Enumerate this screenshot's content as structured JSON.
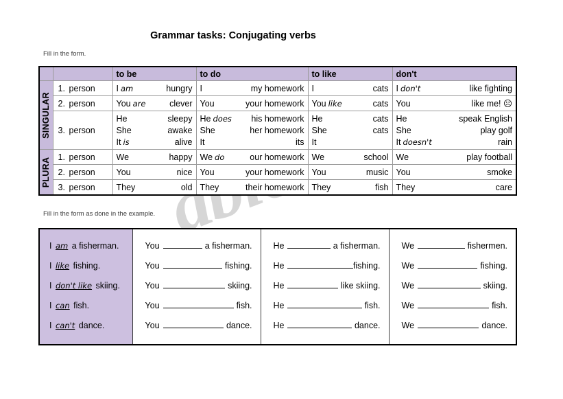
{
  "title": "Grammar tasks: Conjugating verbs",
  "instruction_1": "Fill in the form.",
  "instruction_2": "Fill in the form as done in the example.",
  "watermark": "ables.com",
  "colors": {
    "header_lavender": "#c8bbdc",
    "example_lavender": "#cdc0e0",
    "border": "#9a9a9a",
    "watermark_gray": "#c9c9c9"
  },
  "conjugation": {
    "headers": {
      "corner_a": "",
      "corner_b": "",
      "to_be": "to be",
      "to_do": "to do",
      "to_like": "to like",
      "dont": "don't"
    },
    "groups": [
      {
        "label": "SINGULAR"
      },
      {
        "label": "PLURA"
      }
    ],
    "singular": [
      {
        "person": "1.",
        "person_word": "person",
        "to_be": {
          "lines": [
            {
              "pronoun": "I",
              "answer": "am",
              "tail": "hungry"
            }
          ]
        },
        "to_do": {
          "lines": [
            {
              "pronoun": "I",
              "answer": "",
              "tail": "my homework"
            }
          ]
        },
        "to_like": {
          "lines": [
            {
              "pronoun": "I",
              "answer": "",
              "tail": "cats"
            }
          ]
        },
        "dont": {
          "lines": [
            {
              "pronoun": "I",
              "answer": "don't",
              "tail": "like fighting",
              "inline": true
            }
          ]
        }
      },
      {
        "person": "2.",
        "person_word": "person",
        "to_be": {
          "lines": [
            {
              "pronoun": "You",
              "answer": "are",
              "tail": "clever",
              "inline": true
            }
          ]
        },
        "to_do": {
          "lines": [
            {
              "pronoun": "You",
              "answer": "",
              "tail": "your homework"
            }
          ]
        },
        "to_like": {
          "lines": [
            {
              "pronoun": "You",
              "answer": "like",
              "tail": "cats",
              "inline": true
            }
          ]
        },
        "dont": {
          "lines": [
            {
              "pronoun": "You",
              "answer": "",
              "tail": "like me! ☹"
            }
          ]
        }
      },
      {
        "person": "3.",
        "person_word": "person",
        "to_be": {
          "lines": [
            {
              "pronoun": "He",
              "answer": "",
              "tail": "sleepy"
            },
            {
              "pronoun": "She",
              "answer": "",
              "tail": "awake"
            },
            {
              "pronoun": "It",
              "answer": "is",
              "tail": "alive"
            }
          ]
        },
        "to_do": {
          "lines": [
            {
              "pronoun": "He",
              "answer": "does",
              "tail": "his homework",
              "inline": true
            },
            {
              "pronoun": "She",
              "answer": "",
              "tail": "her homework"
            },
            {
              "pronoun": "It",
              "answer": "",
              "tail": "its"
            }
          ]
        },
        "to_like": {
          "lines": [
            {
              "pronoun": "He",
              "answer": "",
              "tail": "cats"
            },
            {
              "pronoun": "She",
              "answer": "",
              "tail": "cats"
            },
            {
              "pronoun": "It",
              "answer": "",
              "tail": ""
            }
          ]
        },
        "dont": {
          "lines": [
            {
              "pronoun": "He",
              "answer": "",
              "tail": "speak English"
            },
            {
              "pronoun": "She",
              "answer": "",
              "tail": "play golf"
            },
            {
              "pronoun": "It",
              "answer": "doesn't",
              "tail": "rain",
              "inline": true
            }
          ]
        }
      }
    ],
    "plural": [
      {
        "person": "1.",
        "person_word": "person",
        "to_be": {
          "lines": [
            {
              "pronoun": "We",
              "answer": "",
              "tail": "happy"
            }
          ]
        },
        "to_do": {
          "lines": [
            {
              "pronoun": "We",
              "answer": "do",
              "tail": "our homework",
              "inline": true
            }
          ]
        },
        "to_like": {
          "lines": [
            {
              "pronoun": "We",
              "answer": "",
              "tail": "school"
            }
          ]
        },
        "dont": {
          "lines": [
            {
              "pronoun": "We",
              "answer": "",
              "tail": "play football"
            }
          ]
        }
      },
      {
        "person": "2.",
        "person_word": "person",
        "to_be": {
          "lines": [
            {
              "pronoun": "You",
              "answer": "",
              "tail": "nice"
            }
          ]
        },
        "to_do": {
          "lines": [
            {
              "pronoun": "You",
              "answer": "",
              "tail": "your homework"
            }
          ]
        },
        "to_like": {
          "lines": [
            {
              "pronoun": "You",
              "answer": "",
              "tail": "music"
            }
          ]
        },
        "dont": {
          "lines": [
            {
              "pronoun": "You",
              "answer": "",
              "tail": "smoke"
            }
          ]
        }
      },
      {
        "person": "3.",
        "person_word": "person",
        "to_be": {
          "lines": [
            {
              "pronoun": "They",
              "answer": "",
              "tail": "old"
            }
          ]
        },
        "to_do": {
          "lines": [
            {
              "pronoun": "They",
              "answer": "",
              "tail": "their homework"
            }
          ]
        },
        "to_like": {
          "lines": [
            {
              "pronoun": "They",
              "answer": "",
              "tail": "fish"
            }
          ]
        },
        "dont": {
          "lines": [
            {
              "pronoun": "They",
              "answer": "",
              "tail": "care"
            }
          ]
        }
      }
    ]
  },
  "exercise": {
    "example_column": [
      {
        "pronoun": "I",
        "answer": "am",
        "tail": "a fisherman."
      },
      {
        "pronoun": "I",
        "answer": "like",
        "tail": "fishing."
      },
      {
        "pronoun": "I",
        "answer": "don't like",
        "tail": "skiing."
      },
      {
        "pronoun": "I",
        "answer": "can",
        "tail": "fish."
      },
      {
        "pronoun": "I",
        "answer": "can't",
        "tail": "dance."
      }
    ],
    "you_column": [
      {
        "pronoun": "You",
        "tail": "a fisherman."
      },
      {
        "pronoun": "You",
        "tail": "fishing."
      },
      {
        "pronoun": "You",
        "tail": "skiing."
      },
      {
        "pronoun": "You",
        "tail": "fish."
      },
      {
        "pronoun": "You",
        "tail": "dance."
      }
    ],
    "he_column": [
      {
        "pronoun": "He",
        "tail": "a fisherman."
      },
      {
        "pronoun": "He",
        "tail": "fishing."
      },
      {
        "pronoun": "He",
        "tail": "like skiing."
      },
      {
        "pronoun": "He",
        "tail": "fish."
      },
      {
        "pronoun": "He",
        "tail": "dance."
      }
    ],
    "we_column": [
      {
        "pronoun": "We",
        "tail": "fishermen."
      },
      {
        "pronoun": "We",
        "tail": "fishing."
      },
      {
        "pronoun": "We",
        "tail": "skiing."
      },
      {
        "pronoun": "We",
        "tail": "fish."
      },
      {
        "pronoun": "We",
        "tail": "dance."
      }
    ]
  }
}
